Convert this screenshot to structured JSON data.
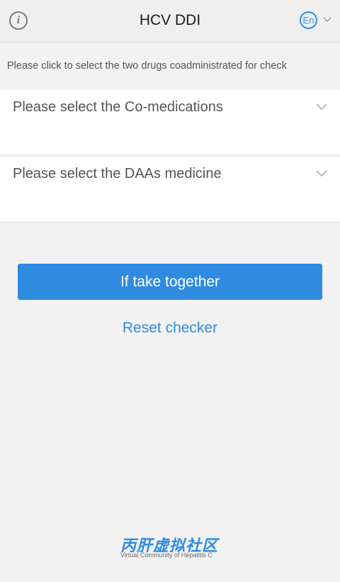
{
  "header": {
    "info_icon": "i",
    "title": "HCV DDI",
    "language": "En"
  },
  "instruction": "Please click to select the two drugs coadministrated for check",
  "selects": {
    "comedication_placeholder": "Please select the Co-medications",
    "daa_placeholder": "Please select the DAAs medicine"
  },
  "actions": {
    "check_label": "If take together",
    "reset_label": "Reset checker"
  },
  "footer": {
    "logo_text": "丙肝虚拟社区",
    "logo_subtitle": "Virtual Community of Hepatitis C"
  },
  "colors": {
    "accent": "#2f8be0",
    "background": "#f2f2f2",
    "header_bg": "#efefef"
  },
  "icons": {
    "info": "info-icon",
    "language": "language-icon",
    "dropdown": "chevron-down-icon"
  }
}
